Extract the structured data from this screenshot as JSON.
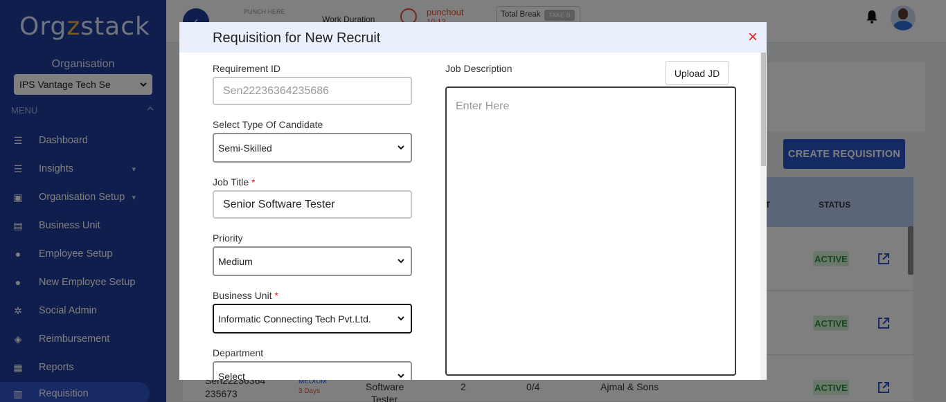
{
  "app": {
    "logo_text_a": "Org",
    "logo_text_z": "z",
    "logo_text_b": "stack"
  },
  "sidebar": {
    "org_label": "Organisation",
    "org_select_value": "IPS Vantage Tech Se",
    "menu_label": "MENU",
    "items": [
      {
        "label": "Dashboard"
      },
      {
        "label": "Insights"
      },
      {
        "label": "Organisation Setup"
      },
      {
        "label": "Business Unit"
      },
      {
        "label": "Employee Setup"
      },
      {
        "label": "New Employee Setup"
      },
      {
        "label": "Social Admin"
      },
      {
        "label": "Reimbursement"
      },
      {
        "label": "Reports"
      },
      {
        "label": "Requisition"
      }
    ]
  },
  "topbar": {
    "punch_label": "PUNCH HERE",
    "work_duration": "Work Duration",
    "punchout": "punchout",
    "punchout_time": "10:12",
    "total_break": "Total Break",
    "break_pill": "TAKE B"
  },
  "page": {
    "create_button": "CREATE REQUISITION",
    "col_partial": "T",
    "col_status": "STATUS",
    "rows": [
      {
        "status": "ACTIVE"
      },
      {
        "status": "ACTIVE"
      },
      {
        "status": "ACTIVE",
        "req_id": "Sen22236364",
        "req_id_2": "235673",
        "priority": "MEDIUM",
        "days": "3 Days",
        "title": "Software",
        "title_2": "Tester",
        "count": "2",
        "ratio": "0/4",
        "company": "Ajmal & Sons"
      }
    ]
  },
  "modal": {
    "title": "Requisition for New Recruit",
    "close_symbol": "×",
    "requirement_id_label": "Requirement ID",
    "requirement_id_value": "Sen22236364235686",
    "candidate_type_label": "Select Type Of Candidate",
    "candidate_type_value": "Semi-Skilled",
    "job_title_label": "Job Title",
    "job_title_value": "Senior Software Tester",
    "priority_label": "Priority",
    "priority_value": "Medium",
    "business_unit_label": "Business Unit",
    "business_unit_value": "Informatic Connecting Tech Pvt.Ltd.",
    "department_label": "Department",
    "department_value": "Select",
    "required_mark": "*",
    "job_description_label": "Job Description",
    "upload_jd_label": "Upload JD",
    "job_description_placeholder": "Enter Here"
  },
  "colors": {
    "sidebar_bg": "#1f3c9b",
    "accent": "#2a55c5",
    "active_green": "#2e8b3c",
    "close_red": "#e21b1b"
  }
}
